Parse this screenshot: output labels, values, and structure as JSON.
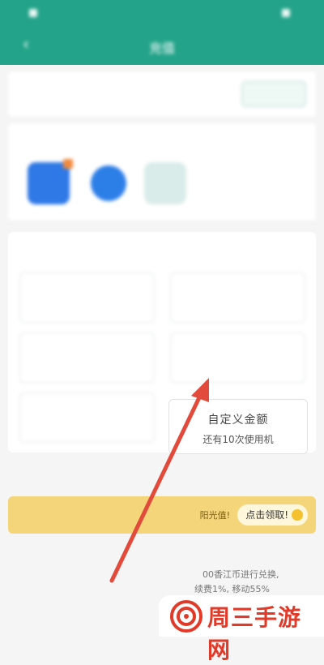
{
  "status": {
    "left": "",
    "right": ""
  },
  "header": {
    "title": "充值",
    "action": ""
  },
  "account": {
    "label": "",
    "value": "",
    "button": ""
  },
  "apps": {
    "title": ""
  },
  "denominations": {
    "title": "",
    "tiles": [
      {
        "amount": "",
        "sub": ""
      },
      {
        "amount": "",
        "sub": ""
      },
      {
        "amount": "",
        "sub": ""
      },
      {
        "amount": "",
        "sub": ""
      },
      {
        "amount": "",
        "sub": ""
      }
    ],
    "custom": {
      "amount": "自定义金额",
      "sub": "还有10次使用机"
    }
  },
  "rules": {
    "title": "",
    "lines": [
      "00香江币进行兑换,",
      "续费1%, 移动55%",
      ""
    ]
  },
  "promo": {
    "text": "阳光值!",
    "button": "点击领取!"
  },
  "watermark": {
    "text": "周三手游网"
  },
  "colors": {
    "brand": "#23a48a",
    "promo": "#f5d57a",
    "annotation_arrow": "#e24a3b"
  }
}
